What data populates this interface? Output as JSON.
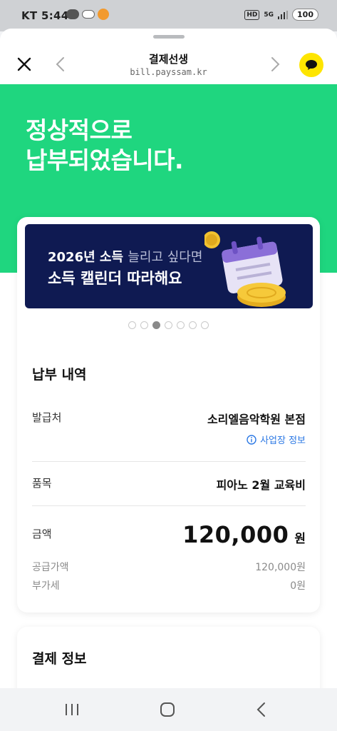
{
  "status_bar": {
    "carrier": "KT",
    "time": "5:44",
    "hd_label": "HD",
    "network_label": "5G",
    "battery": "100"
  },
  "header": {
    "title": "결제선생",
    "url": "bill.payssam.kr"
  },
  "hero": {
    "title_line1": "정상적으로",
    "title_line2": "납부되었습니다."
  },
  "banner": {
    "line1_year": "2026년 소득",
    "line1_rest": "늘리고 싶다면",
    "line2": "소득 캘린더 따라해요",
    "dot_count": 7,
    "active_dot": 3
  },
  "payment_details": {
    "title": "납부 내역",
    "issuer_label": "발급처",
    "issuer_value": "소리엘음악학원 본점",
    "business_info_link": "사업장 정보",
    "item_label": "품목",
    "item_value": "피아노 2월 교육비",
    "amount_label": "금액",
    "amount_value": "120,000",
    "amount_unit": "원",
    "supply_label": "공급가액",
    "supply_value": "120,000원",
    "vat_label": "부가세",
    "vat_value": "0원"
  },
  "payment_info": {
    "title": "결제 정보"
  },
  "colors": {
    "hero_green": "#1fd67f",
    "banner_navy": "#0f1a52",
    "kakao_yellow": "#fee500",
    "link_blue": "#2b78e4"
  }
}
